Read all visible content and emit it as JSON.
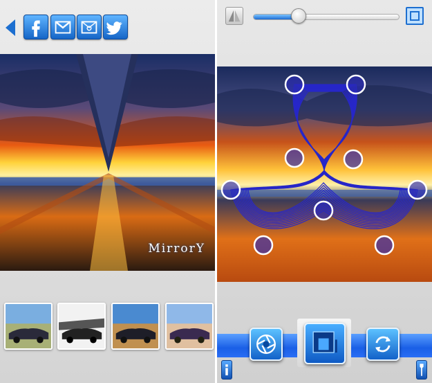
{
  "left_screen": {
    "toolbar": {
      "back_icon": "back-arrow-icon",
      "share_buttons": [
        "facebook-icon",
        "gmail-icon",
        "email-icon",
        "twitter-icon"
      ]
    },
    "brand_text": "MirrorY",
    "thumbnails": [
      "car-photo-original",
      "car-photo-sketch",
      "car-photo-warm",
      "car-photo-cool"
    ]
  },
  "right_screen": {
    "toolbar": {
      "mirror_icon": "mirror-toggle-icon",
      "slider_value": 0.31,
      "frame_icon": "frame-icon"
    },
    "bottom_tools": [
      "aperture-icon",
      "layout-icon",
      "rotate-refresh-icon"
    ],
    "corner_tools": [
      "info-icon",
      "wrench-icon"
    ]
  },
  "colors": {
    "accent": "#1d6fd0",
    "control_ring": "#ffffff",
    "curve": "#2727c8"
  }
}
